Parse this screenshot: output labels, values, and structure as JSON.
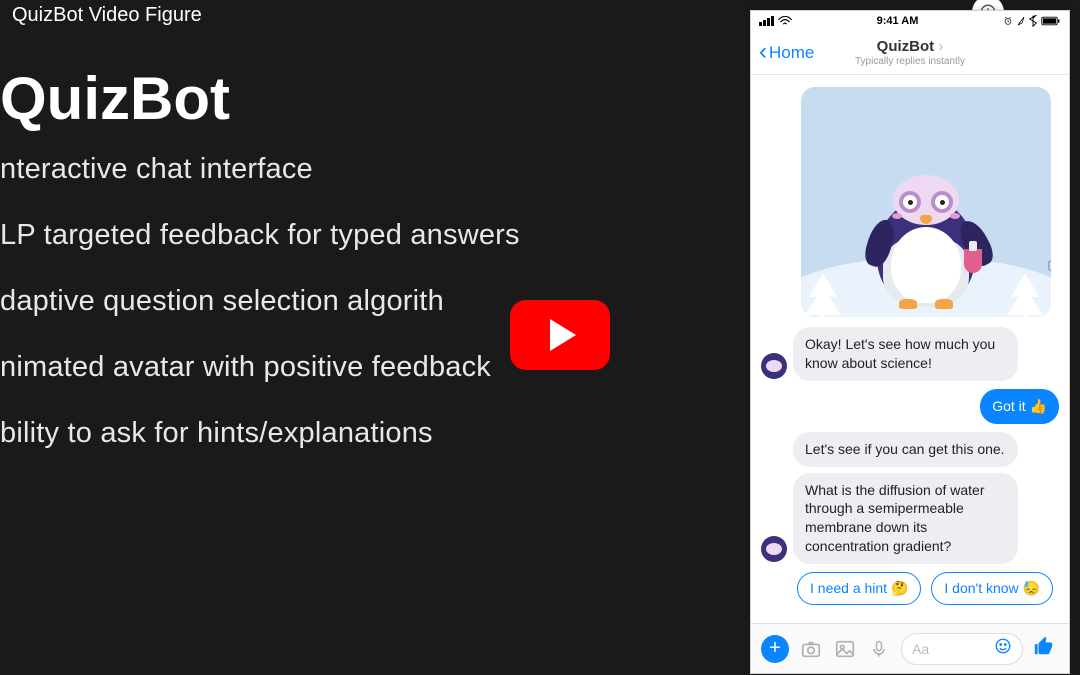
{
  "video": {
    "title": "QuizBot Video Figure",
    "watch_later": "Ver más tarde"
  },
  "slide": {
    "heading": "QuizBot",
    "bullets": [
      "nteractive chat interface",
      "LP targeted feedback for typed answers",
      "daptive question selection algorith",
      "nimated avatar with positive feedback",
      "bility to ask for hints/explanations"
    ]
  },
  "chat": {
    "status_time": "9:41 AM",
    "back_label": "Home",
    "title": "QuizBot",
    "subtitle": "Typically replies instantly",
    "messages": {
      "m1": "Okay! Let's see how much you know about science!",
      "u1": "Got it 👍",
      "m2": "Let's see if you can get this one.",
      "m3": "What is the diffusion of water through a semipermeable membrane down its concentration gradient?"
    },
    "quick_replies": {
      "hint": "I need a hint 🤔",
      "idk": "I don't know 😓"
    },
    "composer_placeholder": "Aa"
  }
}
